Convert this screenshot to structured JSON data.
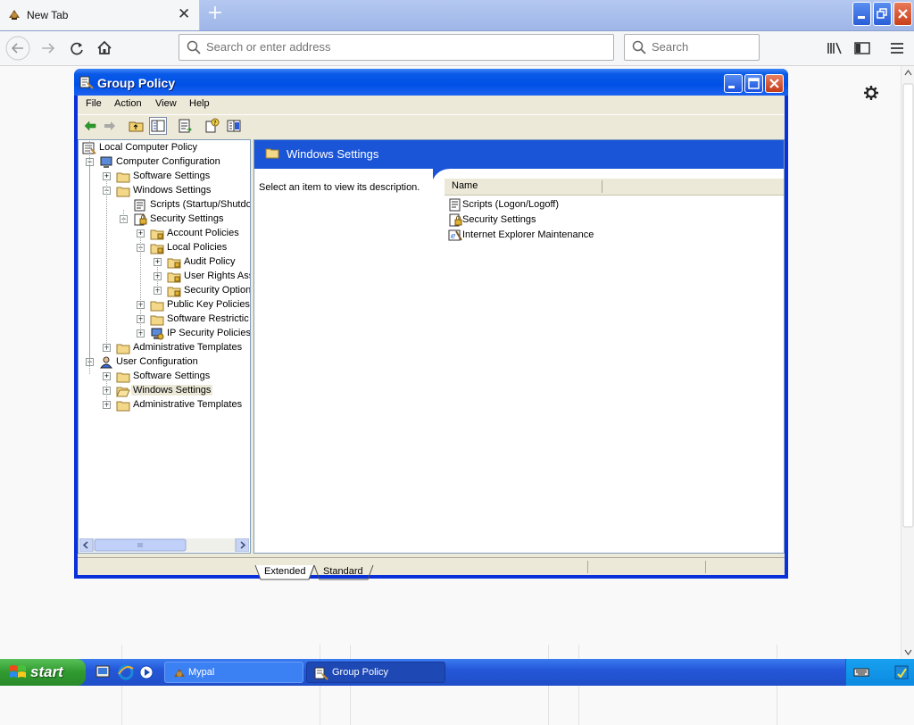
{
  "browser": {
    "tab_title": "New Tab",
    "urlbar_placeholder": "Search or enter address",
    "searchbar_placeholder": "Search"
  },
  "group_policy": {
    "window_title": "Group Policy",
    "menu": [
      "File",
      "Action",
      "View",
      "Help"
    ],
    "tree": [
      "Local Computer Policy",
      "Computer Configuration",
      "Software Settings",
      "Windows Settings",
      "Scripts (Startup/Shutdo",
      "Security Settings",
      "Account Policies",
      "Local Policies",
      "Audit Policy",
      "User Rights Ass",
      "Security Option",
      "Public Key Policies",
      "Software Restrictic",
      "IP Security Policies",
      "Administrative Templates",
      "User Configuration",
      "Software Settings",
      "Windows Settings",
      "Administrative Templates"
    ],
    "right_header": "Windows Settings",
    "description": "Select an item to view its description.",
    "list_column": "Name",
    "list_items": [
      "Scripts (Logon/Logoff)",
      "Security Settings",
      "Internet Explorer Maintenance"
    ],
    "tabs": [
      "Extended",
      "Standard"
    ]
  },
  "taskbar": {
    "start_label": "start",
    "tasks": [
      "Mypal",
      "Group Policy"
    ]
  },
  "colors": {
    "xp_blue": "#0831d9",
    "banner_blue": "#1a55d8",
    "start_green": "#2f9a2f"
  }
}
